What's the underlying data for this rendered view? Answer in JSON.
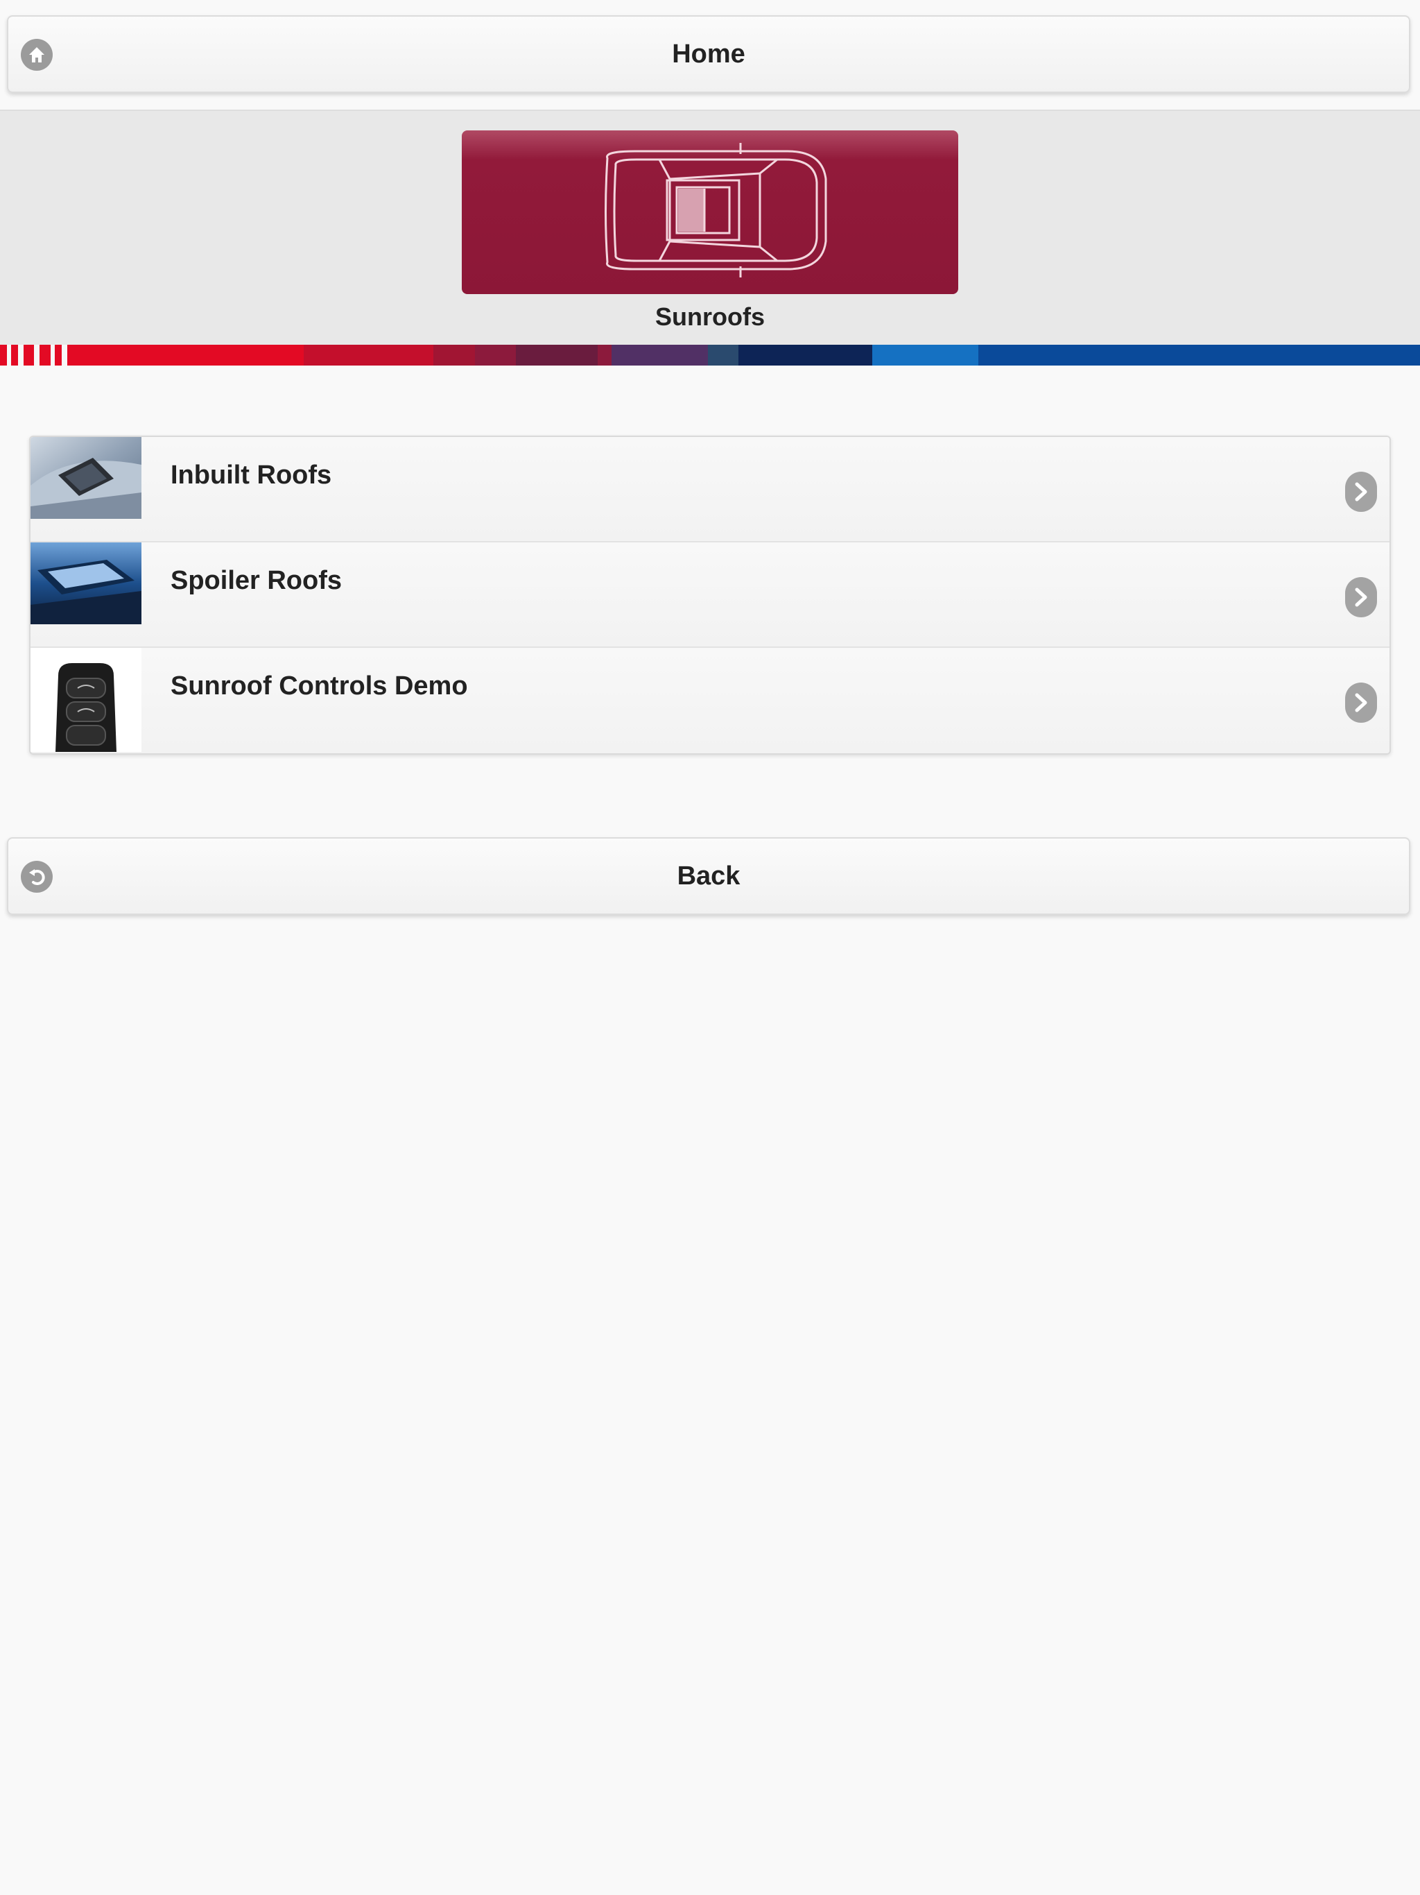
{
  "header": {
    "home_label": "Home",
    "home_icon": "home-icon"
  },
  "hero": {
    "title": "Sunroofs",
    "tile_color": "#8c1737",
    "icon": "car-top-view-icon"
  },
  "list": {
    "items": [
      {
        "label": "Inbuilt Roofs",
        "thumb": "inbuilt-roof-photo"
      },
      {
        "label": "Spoiler Roofs",
        "thumb": "spoiler-roof-photo"
      },
      {
        "label": "Sunroof Controls Demo",
        "thumb": "key-fob-photo"
      }
    ]
  },
  "footer": {
    "back_label": "Back",
    "back_icon": "back-icon"
  },
  "colors": {
    "background": "#f9f9f9",
    "stripe": [
      "#e30a24",
      "#c10f2d",
      "#8a1a3c",
      "#5a2a55",
      "#1e3060",
      "#0b2a5c",
      "#1873c6",
      "#0a4a9a"
    ]
  }
}
